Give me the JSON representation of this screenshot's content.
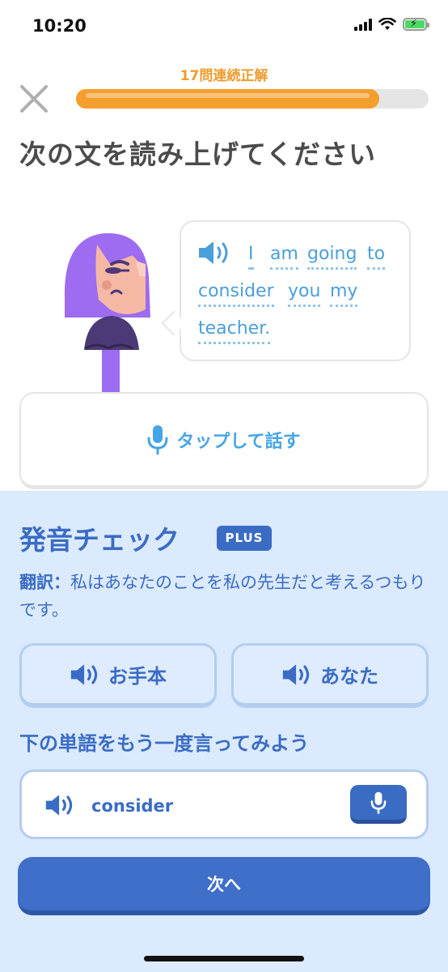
{
  "status_bar": {
    "time": "10:20",
    "icons": [
      "signal-icon",
      "wifi-icon",
      "battery-charging-icon"
    ]
  },
  "header": {
    "close_icon": "close-icon",
    "streak_label": "17問連続正解",
    "progress_fraction": 0.86
  },
  "instruction": "次の文を読み上げてください",
  "prompt": {
    "speaker_icon": "speaker-icon",
    "words": [
      "I",
      "am",
      "going",
      "to",
      "consider",
      "you",
      "my",
      "teacher."
    ]
  },
  "tap_to_speak": {
    "icon": "microphone-icon",
    "label": "タップして話す"
  },
  "pronunciation_panel": {
    "title": "発音チェック",
    "badge": "PLUS",
    "translation_label": "翻訳：",
    "translation_text": "私はあなたのことを私の先生だと考えるつもりです。",
    "model_button_label": "お手本",
    "yours_button_label": "あなた",
    "retry_heading": "下の単語をもう一度言ってみよう",
    "retry_word": "consider",
    "next_button_label": "次へ"
  },
  "colors": {
    "progress": "#f49f2d",
    "streak_text": "#ef9b2d",
    "link_blue": "#4b9fd8",
    "panel_bg": "#dbeafe",
    "panel_text": "#3a6cc4",
    "primary_button": "#3f6fc8"
  }
}
